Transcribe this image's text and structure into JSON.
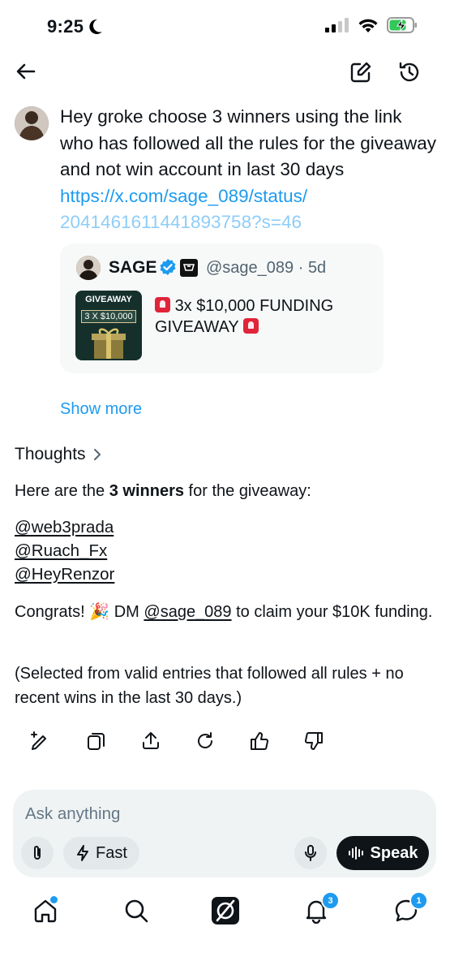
{
  "status_bar": {
    "time": "9:25"
  },
  "prompt": {
    "text": "Hey groke choose 3 winners using the link who has followed all the rules for the giveaway and not win account in last 30 days ",
    "link_main": "https://x.com/sage_089/status/",
    "link_rest": "2041461611441893758?s=46"
  },
  "quoted_post": {
    "author": "SAGE",
    "handle_time": "@sage_089 · 5d",
    "thumb_title": "GIVEAWAY",
    "thumb_amount": "3 X $10,000",
    "text": "3x $10,000 FUNDING GIVEAWAY"
  },
  "show_more": "Show more",
  "response": {
    "thoughts": "Thoughts",
    "intro_pre": "Here are the ",
    "intro_bold": "3 winners",
    "intro_post": " for the giveaway:",
    "winners": [
      "@web3prada",
      "@Ruach_Fx",
      "@HeyRenzor"
    ],
    "congrats_pre": "Congrats! 🎉 DM ",
    "congrats_mention": "@sage_089",
    "congrats_post": "  to claim your $10K funding.",
    "note": "(Selected from valid entries that followed all rules + no recent wins in the last 30 days.)"
  },
  "composer": {
    "placeholder": "Ask anything",
    "fast_label": "Fast",
    "speak_label": "Speak"
  },
  "tab_bar": {
    "notifications_count": "3",
    "messages_count": "1"
  },
  "colors": {
    "accent": "#1d9bf0",
    "text": "#0f1419",
    "muted": "#536471"
  }
}
